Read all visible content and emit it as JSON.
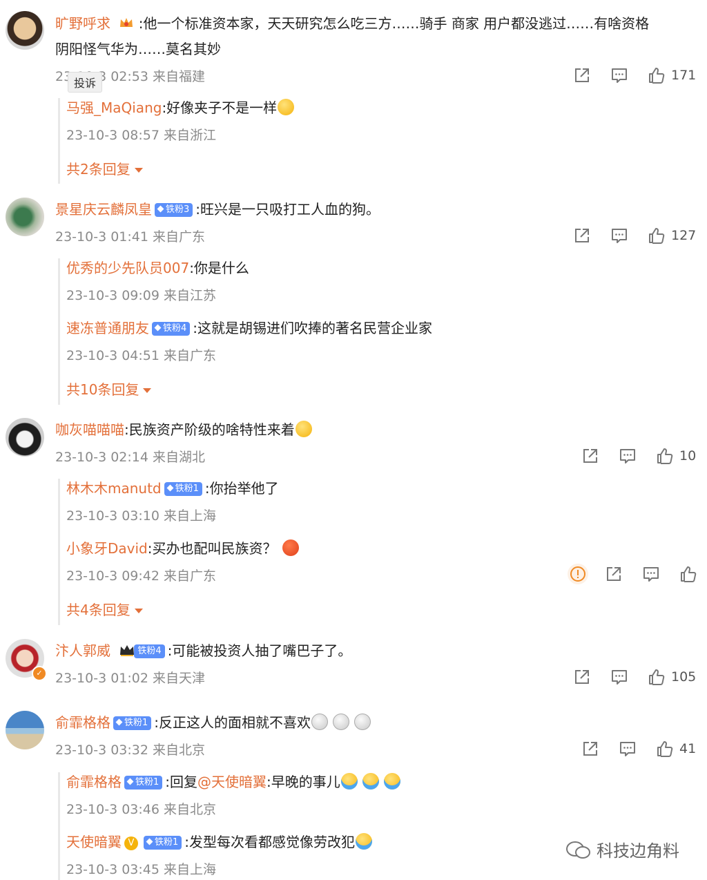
{
  "comments": [
    {
      "user": "旷野呼求",
      "text": ":他一个标准资本家，天天研究怎么吃三方……骑手 商家 用户都没逃过……有啥资格",
      "text2": "阴阳怪气华为……莫名其妙",
      "meta": "23-10-3 02:53 来自福建",
      "likes": "171",
      "replies": [
        {
          "user": "马强_MaQiang",
          "text": ":好像夹子不是一样",
          "meta": "23-10-3 08:57 来自浙江"
        }
      ],
      "more": "共2条回复"
    },
    {
      "user": "景星庆云麟凤皇",
      "badge": "铁粉3",
      "text": ":旺兴是一只吸打工人血的狗。",
      "meta": "23-10-3 01:41 来自广东",
      "likes": "127",
      "replies": [
        {
          "user": "优秀的少先队员007",
          "text": ":你是什么",
          "meta": "23-10-3 09:09 来自江苏"
        },
        {
          "user": "速冻普通朋友",
          "badge": "铁粉4",
          "text": ":这就是胡锡进们吹捧的著名民营企业家",
          "meta": "23-10-3 04:51 来自广东"
        }
      ],
      "more": "共10条回复"
    },
    {
      "user": "咖灰喵喵喵",
      "text": ":民族资产阶级的啥特性来着",
      "meta": "23-10-3 02:14 来自湖北",
      "likes": "10",
      "replies": [
        {
          "user": "林木木manutd",
          "badge": "铁粉1",
          "text": ":你抬举他了",
          "meta": "23-10-3 03:10 来自上海"
        },
        {
          "user": "小象牙David",
          "text": ":买办也配叫民族资？",
          "meta": "23-10-3 09:42 来自广东"
        }
      ],
      "more": "共4条回复"
    },
    {
      "user": "汴人郭威",
      "badge": "铁粉4",
      "text": ":可能被投资人抽了嘴巴子了。",
      "meta": "23-10-3 01:02 来自天津",
      "likes": "105"
    },
    {
      "user": "俞霏格格",
      "badge": "铁粉1",
      "text": ":反正这人的面相就不喜欢",
      "meta": "23-10-3 03:32 来自北京",
      "likes": "41",
      "replies": [
        {
          "user": "俞霏格格",
          "badge": "铁粉1",
          "text_pre": ":回复",
          "mention": "@天使暗翼",
          "text": ":早晚的事儿",
          "meta": "23-10-3 03:46 来自北京"
        },
        {
          "user": "天使暗翼",
          "badge": "铁粉1",
          "text": ":发型每次看都感觉像劳改犯",
          "meta": "23-10-3 03:45 来自上海"
        }
      ]
    }
  ],
  "tooltip": "投诉",
  "watermark": "科技边角料",
  "icons": {
    "share": "share-icon",
    "comment": "comment-icon",
    "like": "thumbs-up-icon",
    "report": "report-icon"
  },
  "colors": {
    "username": "#e3703a",
    "meta": "#8b8b8b",
    "badge": "#5b8ff9"
  }
}
